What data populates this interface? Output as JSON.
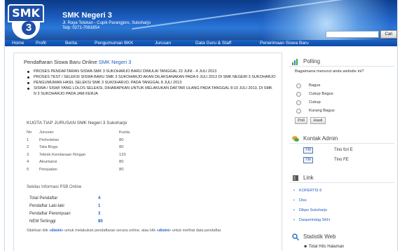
{
  "header": {
    "logo_text": "SMK",
    "logo_number": "3",
    "site_title": "SMK Negeri 3",
    "address": "Jl. Raya Telukan - Cupik Parangjoro, Sukoharjo",
    "phone": "Telp: 0271-7081854",
    "search_placeholder": "",
    "search_button": "Cari"
  },
  "nav": [
    "Home",
    "Profil",
    "Berita",
    "Pengumuman BKK",
    "Jurusan",
    "Data Guru & Staff",
    "Penerimaan Siswa Baru"
  ],
  "content": {
    "title_prefix": "Pendaftaran Siswa Baru Online",
    "title_highlight": "SMK Negeri 3",
    "announcements": [
      "PROSES PENDAFTARAN SISWA SMK 3 SUKOHARJO BARU DIMULAI TANGGAL 22 Juni - 4 JULI 2013",
      "PROSES TEST / SELEKSI SISWA BARU SMK 3 SUKOHARJO AKAN DILAKSANAKAN PADA 6 JULI 2013 DI SMK NEGERI 3 SUKOHARJO",
      "PENGUMUMAN HASIL SELEKSI SMK 3 SUKOHARJO, PADA TANGGAL 8 JULI 2013",
      "SISWA / SISWI YANG LOLOS SELEKSI, DIHARAPKAN UNTUK MELAKUKAN DAFTAR ULANG PADA TANGGAL 8-10 JULI 2013, DI SMK N 3 SUKOHARJO PADA JAM KERJA"
    ],
    "quota_heading": "KUOTA TIAP JURUSAN SMK Negeri 3 Sukoharjo",
    "quota_headers": [
      "No",
      "Jurusan",
      "Kuota"
    ],
    "quota_rows": [
      [
        "1",
        "Perhotelan",
        "80"
      ],
      [
        "2",
        "Tata Boga",
        "80"
      ],
      [
        "3",
        "Teknik Kendaraan Ringan",
        "120"
      ],
      [
        "4",
        "Akuntansi",
        "80"
      ],
      [
        "5",
        "Penjualan",
        "80"
      ]
    ],
    "psb_info": "Sekilas Informasi PSB Online",
    "stats": [
      {
        "label": "Total Pendaftar",
        "value": "4"
      },
      {
        "label": "Pendaftar Laki-laki",
        "value": "1"
      },
      {
        "label": "Pendaftar Perempuan",
        "value": "3"
      },
      {
        "label": "NEM Tertinggi",
        "value": "80"
      }
    ],
    "note_part1": "Silahkan klik",
    "note_link1": "«disini»",
    "note_part2": "untuk melakukan pendaftaran secara online, atau klik",
    "note_link2": "«disini»",
    "note_part3": "untuk melihat data pendaftar."
  },
  "sidebar": {
    "polling": {
      "title": "Polling",
      "question": "Bagaimana menurut anda website ini?",
      "options": [
        "Bagus",
        "Cukup Bagus",
        "Cukup",
        "Kurang Bagus"
      ],
      "vote_button": "Poll",
      "result_button": "Hasil"
    },
    "admin": {
      "title": "Kontak Admin",
      "contacts": [
        {
          "badge": "YM",
          "name": "Tino fcri E"
        },
        {
          "badge": "YM",
          "name": "Tino FE"
        }
      ]
    },
    "links": {
      "title": "Link",
      "items": [
        "KOPERTIS 6",
        "Diss",
        "Dikpo Sukoharjo",
        "Dasperindag SKH"
      ]
    },
    "web_stats": {
      "title": "Statistik Web",
      "first_row": "Total Hits Halaman"
    }
  },
  "colors": {
    "header_blue": "#1c5ec0",
    "nav_blue": "#0d4aa4",
    "link_blue": "#1e5fc2"
  }
}
